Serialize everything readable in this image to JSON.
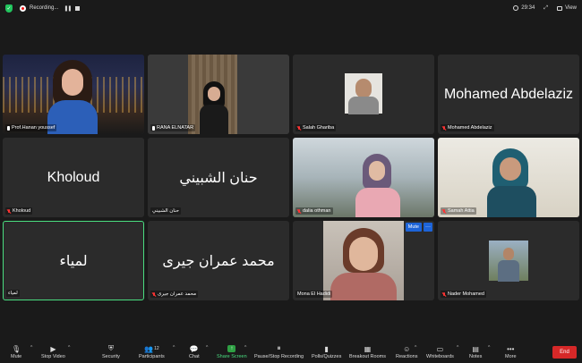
{
  "topbar": {
    "recording_label": "Recording...",
    "pause_glyph": "❚❚",
    "timer": "29:34",
    "view_label": "View"
  },
  "participants": [
    {
      "name": "Prof.Hanan youssef",
      "type": "video",
      "mic": "on"
    },
    {
      "name": "RANA ELNATAR",
      "type": "video",
      "mic": "on"
    },
    {
      "name": "Salah Ghariba",
      "type": "photo",
      "mic": "off"
    },
    {
      "name": "Mohamed Abdelaziz",
      "type": "name",
      "display": "Mohamed Abdelaziz",
      "mic": "off"
    },
    {
      "name": "Kholoud",
      "type": "name",
      "display": "Kholoud",
      "mic": "off"
    },
    {
      "name": "حنان الشبيني",
      "type": "name",
      "display": "حنان الشبيني",
      "mic": "none"
    },
    {
      "name": "dalia othman",
      "type": "video",
      "mic": "off"
    },
    {
      "name": "Samah Attia",
      "type": "video",
      "mic": "off"
    },
    {
      "name": "لمياء",
      "type": "name",
      "display": "لمياء",
      "mic": "none",
      "active": true
    },
    {
      "name": "محمد عمران جيرى",
      "type": "name",
      "display": "محمد عمران جيرى",
      "mic": "off"
    },
    {
      "name": "Mona El Hadidi",
      "type": "photo",
      "mic": "none",
      "mute_label": "Mute",
      "more_label": "···"
    },
    {
      "name": "Nader Mohamed",
      "type": "photo",
      "mic": "off"
    }
  ],
  "toolbar": {
    "mute": "Mute",
    "stop_video": "Stop Video",
    "security": "Security",
    "participants": "Participants",
    "participants_count": "12",
    "chat": "Chat",
    "share_screen": "Share Screen",
    "pause_stop_recording": "Pause/Stop Recording",
    "polls": "Polls/Quizzes",
    "breakout": "Breakout Rooms",
    "reactions": "Reactions",
    "whiteboards": "Whiteboards",
    "notes": "Notes",
    "more": "More",
    "end": "End"
  },
  "colors": {
    "active_speaker": "#4ade80",
    "end_button": "#d62828",
    "share_button": "#2ea043",
    "mute_badge": "#1d64d8",
    "muted_mic": "#ff3333"
  }
}
